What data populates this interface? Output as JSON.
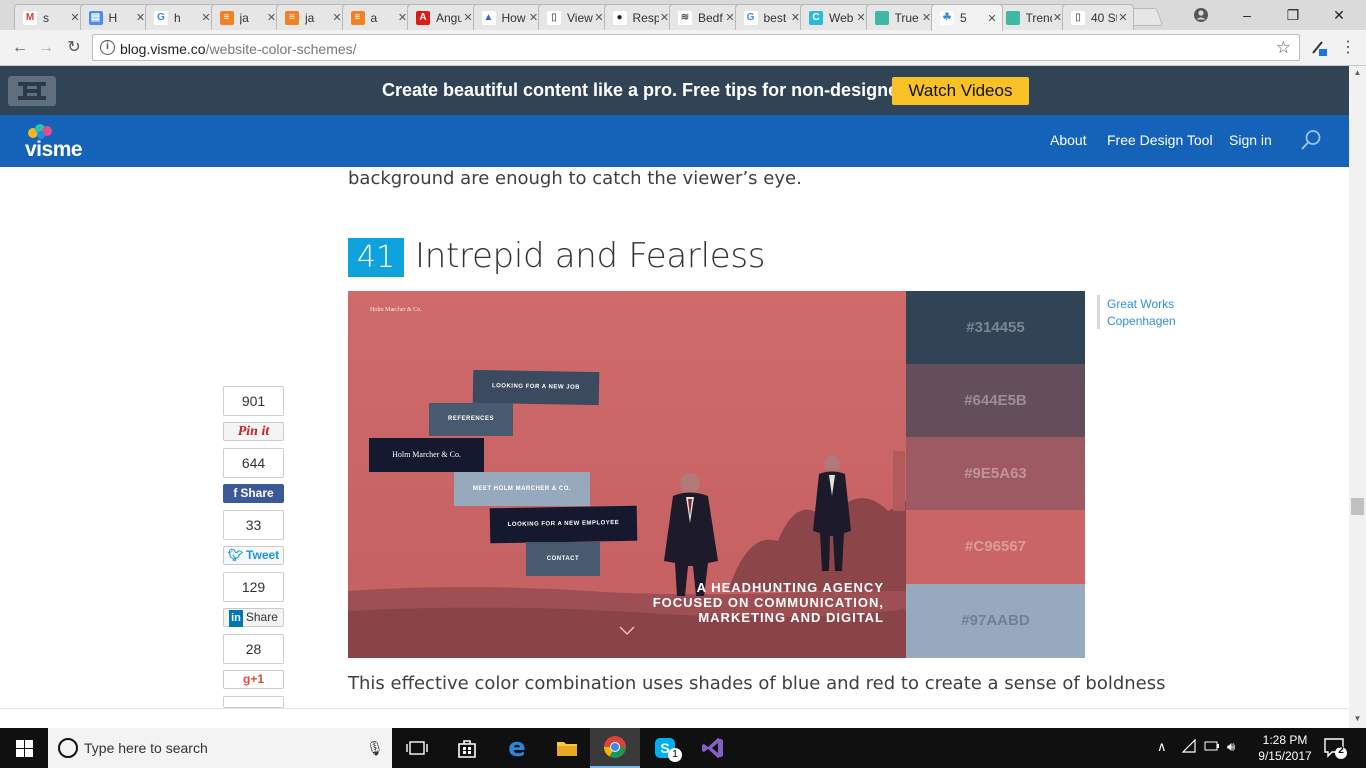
{
  "browser": {
    "tabs": [
      {
        "label": "s",
        "fav": "M",
        "fav_color": "#ffffff",
        "fav_text": "#d23f31"
      },
      {
        "label": "H",
        "fav": "▤",
        "fav_color": "#4a8af4",
        "fav_text": "#ffffff"
      },
      {
        "label": "h",
        "fav": "G",
        "fav_color": "#ffffff",
        "fav_text": "#4285f4"
      },
      {
        "label": "ja",
        "fav": "≡",
        "fav_color": "#f48024",
        "fav_text": "#ffffff"
      },
      {
        "label": "ja",
        "fav": "≡",
        "fav_color": "#f48024",
        "fav_text": "#ffffff"
      },
      {
        "label": "a",
        "fav": "≡",
        "fav_color": "#f48024",
        "fav_text": "#ffffff"
      },
      {
        "label": "Angu",
        "fav": "A",
        "fav_color": "#dd1b16",
        "fav_text": "#ffffff"
      },
      {
        "label": "How",
        "fav": "▲",
        "fav_color": "#ffffff",
        "fav_text": "#3367d6"
      },
      {
        "label": "View",
        "fav": "▯",
        "fav_color": "#ffffff",
        "fav_text": "#777777"
      },
      {
        "label": "Resp",
        "fav": "●",
        "fav_color": "#ffffff",
        "fav_text": "#222222"
      },
      {
        "label": "Bedf",
        "fav": "≋",
        "fav_color": "#ffffff",
        "fav_text": "#555555"
      },
      {
        "label": "best",
        "fav": "G",
        "fav_color": "#ffffff",
        "fav_text": "#4285f4"
      },
      {
        "label": "Web",
        "fav": "C",
        "fav_color": "#2bbbd8",
        "fav_text": "#ffffff"
      },
      {
        "label": "True",
        "fav": "",
        "fav_color": "#3fb8a3",
        "fav_text": "#ffffff"
      },
      {
        "label": "5",
        "fav": "☘",
        "fav_color": "#ffffff",
        "fav_text": "#2e8ccf",
        "active": true
      },
      {
        "label": "Trend",
        "fav": "",
        "fav_color": "#3fb8a3",
        "fav_text": "#ffffff"
      },
      {
        "label": "40 St",
        "fav": "▯",
        "fav_color": "#ffffff",
        "fav_text": "#777777"
      }
    ],
    "url_host": "blog.visme.co",
    "url_path": "/website-color-schemes/"
  },
  "promo": {
    "text": "Create beautiful content like a pro. Free tips for non-designers",
    "button": "Watch Videos"
  },
  "nav": {
    "logo": "visme",
    "about": "About",
    "design_tool": "Free Design Tool",
    "sign_in": "Sign in"
  },
  "article": {
    "prev_text": "background are enough to catch the viewer’s eye.",
    "section_number": "41",
    "section_title": "Intrepid and Fearless",
    "next_text": "This effective color combination uses shades of blue and red to create a sense of boldness",
    "credit_line1": "Great Works",
    "credit_line2": "Copenhagen"
  },
  "hero": {
    "top_tag": "Holm Marcher & Co.",
    "menu": {
      "looking_job": "LOOKING FOR A NEW JOB",
      "references": "REFERENCES",
      "brand": "Holm Marcher & Co.",
      "meet": "MEET HOLM MARCHER & CO.",
      "looking_employee": "LOOKING FOR A NEW EMPLOYEE",
      "contact": "CONTACT"
    },
    "headline_1": "A HEADHUNTING AGENCY",
    "headline_2": "FOCUSED ON COMMUNICATION,",
    "headline_3": "MARKETING AND DIGITAL"
  },
  "palette": [
    "#314455",
    "#644E5B",
    "#9E5A63",
    "#C96567",
    "#97AABD"
  ],
  "share": {
    "pinterest_count": "901",
    "pinterest_label": "Pin it",
    "facebook_count": "644",
    "facebook_label": "Share",
    "twitter_count": "33",
    "twitter_label": "Tweet",
    "linkedin_count": "129",
    "linkedin_label": "Share",
    "gplus_count": "28",
    "gplus_label": "+1"
  },
  "taskbar": {
    "search_placeholder": "Type here to search",
    "time": "1:28 PM",
    "date": "9/15/2017",
    "skype_badge": "1",
    "notif_count": "2"
  }
}
